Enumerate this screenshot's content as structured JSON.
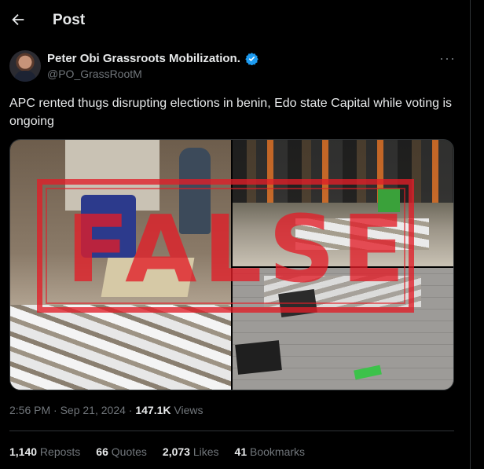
{
  "header": {
    "title": "Post",
    "back_icon": "arrow-left-icon"
  },
  "author": {
    "name": "Peter Obi Grassroots Mobilization.",
    "handle": "@PO_GrassRootM",
    "verified_color": "#1d9bf0",
    "more_label": "···"
  },
  "tweet": {
    "text": "APC rented thugs disrupting elections in benin, Edo state Capital while voting is ongoing"
  },
  "media": {
    "overlay_label": "FALSE",
    "overlay_color": "#e11e28"
  },
  "meta": {
    "time": "2:56 PM",
    "dot1": " · ",
    "date": "Sep 21, 2024",
    "dot2": " · ",
    "views_count": "147.1K",
    "views_label": " Views"
  },
  "stats": [
    {
      "count": "1,140",
      "label": " Reposts"
    },
    {
      "count": "66",
      "label": " Quotes"
    },
    {
      "count": "2,073",
      "label": " Likes"
    },
    {
      "count": "41",
      "label": " Bookmarks"
    }
  ]
}
